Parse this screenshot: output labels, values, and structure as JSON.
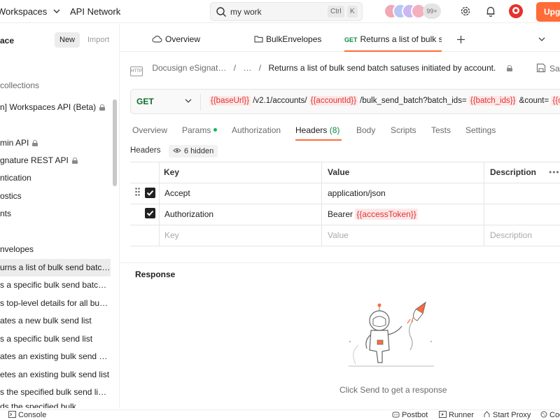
{
  "topbar": {
    "workspaces": "Workspaces",
    "api_network": "API Network",
    "search_value": "my work",
    "kbd_ctrl": "Ctrl",
    "kbd_k": "K",
    "avatar_count": "99+",
    "upgrade": "Upgrade"
  },
  "sidebar": {
    "workspace_name": "ace",
    "new_button": "New",
    "import_button": "Import",
    "items": [
      {
        "label": "collections"
      },
      {
        "label": "n] Workspaces API (Beta)"
      },
      {
        "label": "min API"
      },
      {
        "label": "gnature REST API"
      },
      {
        "label": "ntication"
      },
      {
        "label": "ostics"
      },
      {
        "label": "nts"
      },
      {
        "label": "nvelopes"
      },
      {
        "label": "urns a list of bulk send batc…"
      },
      {
        "label": "s a specific bulk send batc…"
      },
      {
        "label": "s top-level details for all bu…"
      },
      {
        "label": "ates a new bulk send list"
      },
      {
        "label": "s a specific bulk send list"
      },
      {
        "label": "ates an existing bulk send …"
      },
      {
        "label": "etes an existing bulk send list"
      },
      {
        "label": "s the specified bulk send li…"
      },
      {
        "label": "ds the specified bulk…"
      }
    ]
  },
  "tabs": [
    {
      "label": "Overview"
    },
    {
      "label": "BulkEnvelopes"
    },
    {
      "method": "GET",
      "label": "Returns a list of bulk ser"
    }
  ],
  "breadcrumb": {
    "badge": "HTTP",
    "collection": "Docusign eSignat…",
    "sep1": "/",
    "ellipsis": "…",
    "sep2": "/",
    "current": "Returns a list of bulk send batch satuses initiated by account.",
    "save": "Save"
  },
  "request": {
    "method": "GET",
    "url_parts": [
      {
        "text": "{{baseUrl}}",
        "var": true
      },
      {
        "text": " /v2.1/accounts/ ",
        "var": false
      },
      {
        "text": "{{accountId}}",
        "var": true
      },
      {
        "text": " /bulk_send_batch?batch_ids= ",
        "var": false
      },
      {
        "text": "{{batch_ids}}",
        "var": true
      },
      {
        "text": " &count= ",
        "var": false
      },
      {
        "text": "{{count}}",
        "var": true
      }
    ]
  },
  "subtabs": [
    {
      "label": "Overview"
    },
    {
      "label": "Params"
    },
    {
      "label": "Authorization"
    },
    {
      "label": "Headers",
      "count": "(8)"
    },
    {
      "label": "Body"
    },
    {
      "label": "Scripts"
    },
    {
      "label": "Tests"
    },
    {
      "label": "Settings"
    }
  ],
  "headers_section": {
    "title": "Headers",
    "hidden": "6 hidden",
    "columns": {
      "key": "Key",
      "value": "Value",
      "description": "Description"
    },
    "rows": [
      {
        "key": "Accept",
        "value": "application/json",
        "value_var": "",
        "checked": true
      },
      {
        "key": "Authorization",
        "value": "Bearer",
        "value_var": "{{accessToken}}",
        "checked": true
      }
    ],
    "placeholder": {
      "key": "Key",
      "value": "Value",
      "description": "Description"
    }
  },
  "response": {
    "title": "Response",
    "hint": "Click Send to get a response"
  },
  "statusbar": {
    "console": "Console",
    "postbot": "Postbot",
    "runner": "Runner",
    "proxy": "Start Proxy",
    "cookies": "Cookies"
  },
  "colors": {
    "accent": "#ff6c37",
    "var_red": "#e03131",
    "method_green": "#0b6e30",
    "dot_green": "#0cbb52"
  }
}
